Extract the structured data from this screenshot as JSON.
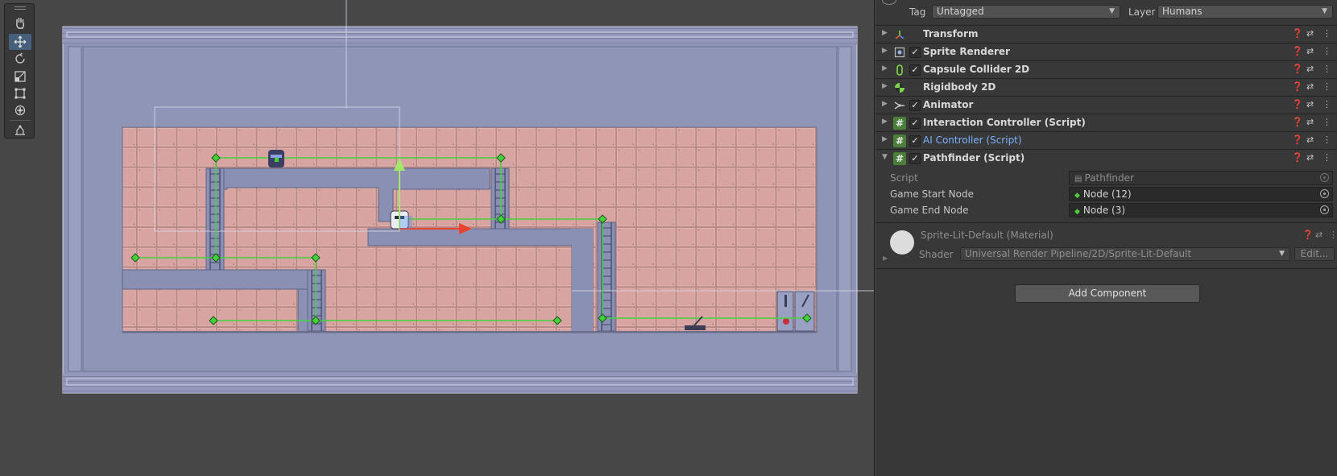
{
  "inspector": {
    "tag_label": "Tag",
    "tag_value": "Untagged",
    "layer_label": "Layer",
    "layer_value": "Humans",
    "components": [
      {
        "name": "Transform",
        "icon": "transform-axes-icon",
        "checkbox": false
      },
      {
        "name": "Sprite Renderer",
        "icon": "sprite-renderer-icon",
        "checkbox": true
      },
      {
        "name": "Capsule Collider 2D",
        "icon": "capsule-collider-icon",
        "checkbox": true
      },
      {
        "name": "Rigidbody 2D",
        "icon": "rigidbody-icon",
        "checkbox": false
      },
      {
        "name": "Animator",
        "icon": "animator-icon",
        "checkbox": true
      },
      {
        "name": "Interaction Controller (Script)",
        "icon": "script-hash-icon",
        "checkbox": true
      },
      {
        "name": "AI Controller (Script)",
        "icon": "script-hash-icon",
        "checkbox": true
      },
      {
        "name": "Pathfinder (Script)",
        "icon": "script-hash-icon",
        "checkbox": true
      }
    ],
    "pathfinder_fields": {
      "script_label": "Script",
      "script_value": "Pathfinder",
      "start_label": "Game Start Node",
      "start_value": "Node (12)",
      "end_label": "Game End Node",
      "end_value": "Node (3)"
    },
    "material": {
      "name": "Sprite-Lit-Default (Material)",
      "shader_label": "Shader",
      "shader_value": "Universal Render Pipeline/2D/Sprite-Lit-Default",
      "edit_label": "Edit..."
    },
    "add_component_label": "Add Component"
  },
  "scene_toolbar": {
    "tools": [
      "hand-tool-icon",
      "move-tool-icon",
      "rotate-tool-icon",
      "scale-tool-icon",
      "rect-tool-icon",
      "transform-tool-icon",
      "custom-tool-icon"
    ],
    "active_tool": "move-tool-icon"
  },
  "colors": {
    "scene_bg": "#474747",
    "level_frame": "#8d93b5",
    "tiles": "#d7a4a1",
    "path_lines": "#44d23c",
    "x_axis": "#e8432f",
    "y_axis": "#a4e86b",
    "link_blue": "#7ab2ff"
  }
}
